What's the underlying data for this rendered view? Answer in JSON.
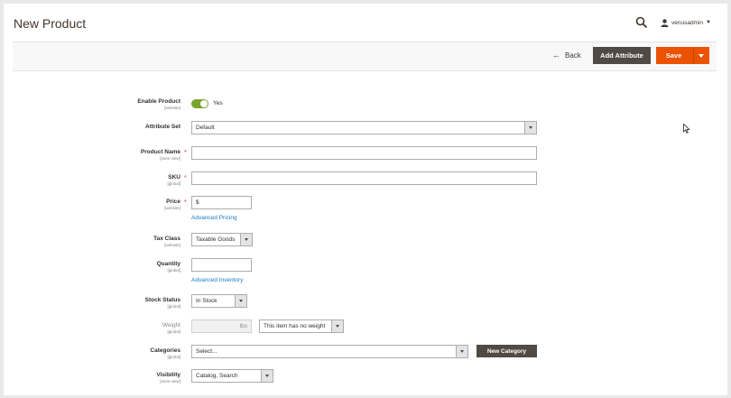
{
  "header": {
    "title": "New Product",
    "username": "venusadmin"
  },
  "actions": {
    "back_label": "Back",
    "add_attribute_label": "Add Attribute",
    "save_label": "Save"
  },
  "form": {
    "enable_product": {
      "label": "Enable Product",
      "scope": "[website]",
      "value": "Yes"
    },
    "attribute_set": {
      "label": "Attribute Set",
      "value": "Default"
    },
    "product_name": {
      "label": "Product Name",
      "scope": "[store view]",
      "value": ""
    },
    "sku": {
      "label": "SKU",
      "scope": "[global]",
      "value": ""
    },
    "price": {
      "label": "Price",
      "scope": "[website]",
      "currency": "$",
      "link": "Advanced Pricing"
    },
    "tax_class": {
      "label": "Tax Class",
      "scope": "[website]",
      "value": "Taxable Goods"
    },
    "quantity": {
      "label": "Quantity",
      "scope": "[global]",
      "value": "",
      "link": "Advanced Inventory"
    },
    "stock_status": {
      "label": "Stock Status",
      "scope": "[global]",
      "value": "In Stock"
    },
    "weight": {
      "label": "Weight",
      "scope": "[global]",
      "unit": "lbs",
      "weight_type": "This item has no weight"
    },
    "categories": {
      "label": "Categories",
      "scope": "[global]",
      "placeholder": "Select...",
      "new_button": "New Category"
    },
    "visibility": {
      "label": "Visibility",
      "scope": "[store view]",
      "value": "Catalog, Search"
    }
  },
  "colors": {
    "accent": "#eb5202",
    "dark_button": "#514943",
    "toggle_on": "#79a22e",
    "link": "#1979c3",
    "required": "#e22626"
  }
}
